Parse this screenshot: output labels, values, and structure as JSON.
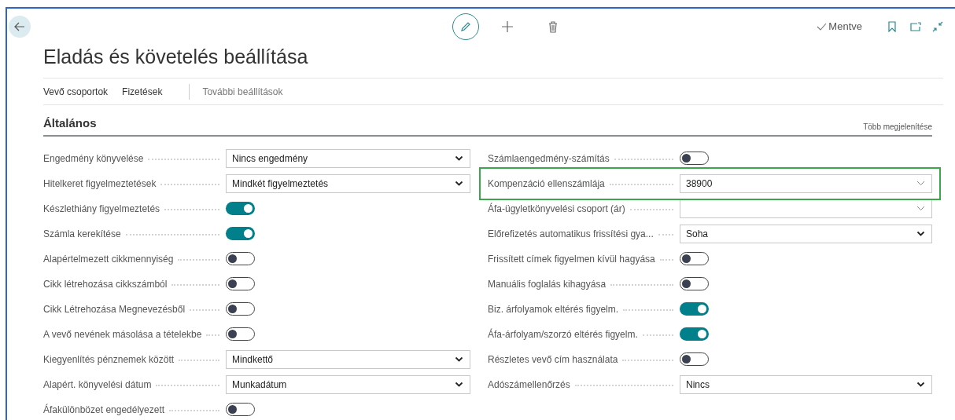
{
  "status": "Mentve",
  "title": "Eladás és követelés beállítása",
  "actions": [
    {
      "label": "Vevő csoportok",
      "kind": "action"
    },
    {
      "label": "Fizetések",
      "kind": "action"
    },
    {
      "label": "További beállítások",
      "kind": "more"
    }
  ],
  "section": {
    "title": "Általános",
    "show_more": "Több megjelenítése",
    "left": [
      {
        "label": "Engedmény könyvelése",
        "kind": "select",
        "value": "Nincs engedmény"
      },
      {
        "label": "Hitelkeret figyelmeztetések",
        "kind": "select",
        "value": "Mindkét figyelmeztetés"
      },
      {
        "label": "Készlethiány figyelmeztetés",
        "kind": "toggle",
        "on": true
      },
      {
        "label": "Számla kerekítése",
        "kind": "toggle",
        "on": true
      },
      {
        "label": "Alapértelmezett cikkmennyiség",
        "kind": "toggle",
        "on": false
      },
      {
        "label": "Cikk létrehozása cikkszámból",
        "kind": "toggle",
        "on": false
      },
      {
        "label": "Cikk Létrehozása Megnevezésből",
        "kind": "toggle",
        "on": false
      },
      {
        "label": "A vevő nevének másolása a tételekbe",
        "kind": "toggle",
        "on": false
      },
      {
        "label": "Kiegyenlítés pénznemek között",
        "kind": "select",
        "value": "Mindkettő"
      },
      {
        "label": "Alapért. könyvelési dátum",
        "kind": "select",
        "value": "Munkadátum"
      },
      {
        "label": "Áfakülönbözet engedélyezett",
        "kind": "toggle",
        "on": false
      }
    ],
    "right": [
      {
        "label": "Számlaengedmény-számítás",
        "kind": "toggle",
        "on": false,
        "highlighted": false
      },
      {
        "label": "Kompenzáció ellenszámlája",
        "kind": "lookup",
        "value": "38900",
        "highlighted": true
      },
      {
        "label": "Áfa-ügyletkönyvelési csoport (ár)",
        "kind": "lookup",
        "highlighted": false
      },
      {
        "label": "Előrefizetés automatikus frissítési gya...",
        "kind": "select",
        "value": "Soha",
        "highlighted": false
      },
      {
        "label": "Frissített címek figyelmen kívül hagyása",
        "kind": "toggle",
        "on": false,
        "highlighted": false
      },
      {
        "label": "Manuális foglalás kihagyása",
        "kind": "toggle",
        "on": false,
        "highlighted": false
      },
      {
        "label": "Biz. árfolyamok eltérés figyelm.",
        "kind": "toggle",
        "on": true,
        "highlighted": false
      },
      {
        "label": "Áfa-árfolyam/szorzó eltérés figyelm.",
        "kind": "toggle",
        "on": true,
        "highlighted": false
      },
      {
        "label": "Részletes vevő cím használata",
        "kind": "toggle",
        "on": false,
        "highlighted": false
      },
      {
        "label": "Adószámellenőrzés",
        "kind": "select",
        "value": "Nincs",
        "highlighted": false
      }
    ]
  }
}
